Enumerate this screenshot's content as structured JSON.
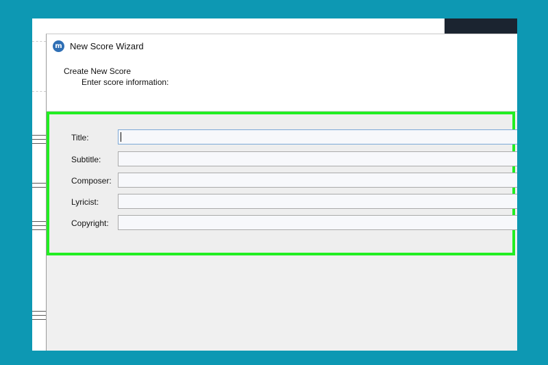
{
  "dialog": {
    "title": "New Score Wizard",
    "icon": "musescore-logo-icon",
    "header_title": "Create New Score",
    "header_subtitle": "Enter score information:"
  },
  "form": {
    "fields": [
      {
        "label": "Title:",
        "value": ""
      },
      {
        "label": "Subtitle:",
        "value": ""
      },
      {
        "label": "Composer:",
        "value": ""
      },
      {
        "label": "Lyricist:",
        "value": ""
      },
      {
        "label": "Copyright:",
        "value": ""
      }
    ]
  },
  "colors": {
    "background": "#0d98b3",
    "highlight": "#22ee22",
    "dialog": "#f0f0f0"
  }
}
